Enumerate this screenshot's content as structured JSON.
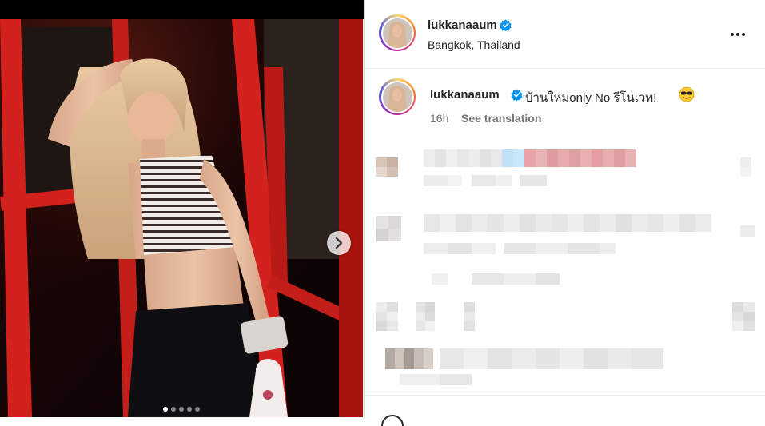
{
  "post": {
    "username": "lukkanaaum",
    "location": "Bangkok, Thailand",
    "caption": "บ้านใหม่only No รีโนเวท!",
    "caption_emoji": "smiling-face-with-sunglasses",
    "time_ago": "16h",
    "see_translation": "See translation",
    "verified": true
  },
  "media": {
    "slide_count": 5,
    "active_slide": 1,
    "next_icon": "chevron-right-icon"
  },
  "icons": {
    "more": "more-options-icon",
    "verified": "verified-badge-icon",
    "emoji": "sunglasses-emoji-icon"
  },
  "colors": {
    "verified": "#0095f6",
    "secondary_text": "#737373",
    "frame_red": "#d3221e"
  }
}
